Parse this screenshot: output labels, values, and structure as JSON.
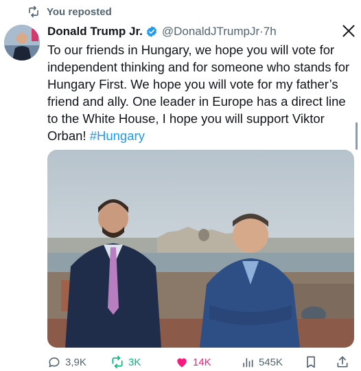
{
  "repost_banner": {
    "text": "You reposted"
  },
  "tweet": {
    "author_name": "Donald Trump Jr.",
    "handle_time": "@DonaldJTrumpJr·7h",
    "text": "To our friends in Hungary, we hope you will vote for independent thinking and for someone who stands for Hungary First. We hope you will vote for my father’s friend and ally. One leader in Europe has a direct line to the White House, I hope you will support Viktor Orban! ",
    "hashtag": "#Hungary"
  },
  "actions": {
    "replies": "3,9K",
    "reposts": "3K",
    "likes": "14K",
    "views": "545K"
  },
  "colors": {
    "accent": "#1d9bf0",
    "repost_green": "#00ba7c",
    "like_pink": "#f91880",
    "muted": "#536471"
  },
  "icons": [
    "repost-icon",
    "verified-badge-icon",
    "x-logo-icon",
    "reply-icon",
    "like-icon",
    "views-icon",
    "bookmark-icon",
    "share-icon"
  ]
}
